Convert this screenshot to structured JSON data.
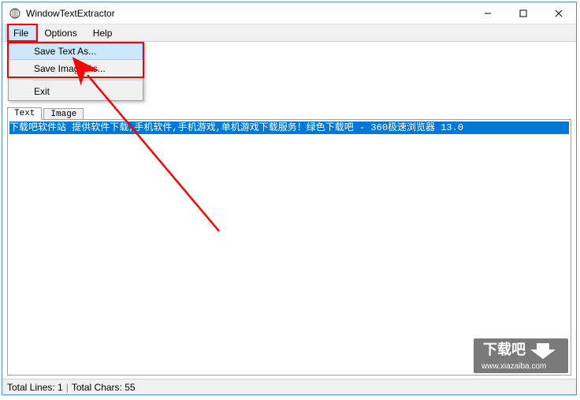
{
  "titlebar": {
    "title": "WindowTextExtractor"
  },
  "menubar": {
    "file": "File",
    "options": "Options",
    "help": "Help"
  },
  "dropdown": {
    "save_text": "Save Text As...",
    "save_image": "Save Image As...",
    "exit": "Exit"
  },
  "tabs": {
    "text": "Text",
    "image": "Image"
  },
  "content": {
    "selected_text": "下载吧软件站 提供软件下载,手机软件,手机游戏,单机游戏下载服务！绿色下载吧 - 360极速浏览器 13.0"
  },
  "statusbar": {
    "lines_label": "Total Lines:",
    "lines_value": "1",
    "chars_label": "Total Chars:",
    "chars_value": "55"
  },
  "watermark": {
    "brand": "下载吧",
    "url": "www.xiazaiba.com"
  }
}
